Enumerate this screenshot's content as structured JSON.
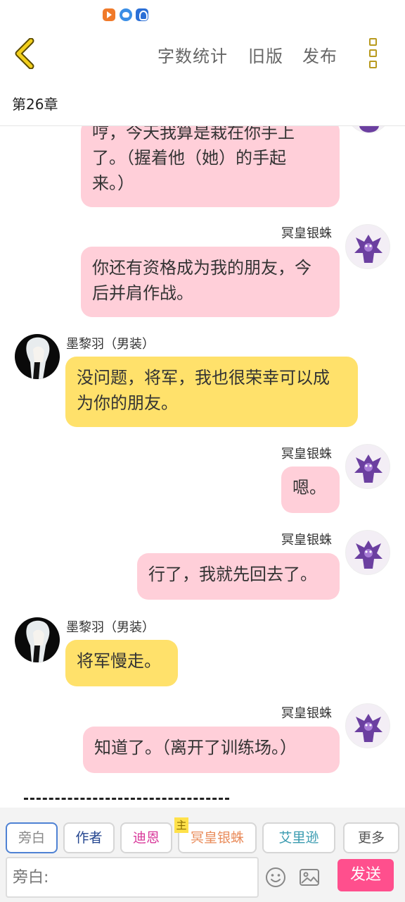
{
  "status_bar": {
    "icons": [
      "play-app-icon",
      "bird-app-icon",
      "bulb-app-icon"
    ]
  },
  "toolbar": {
    "back_icon": "chevron-left-icon",
    "word_count_label": "字数统计",
    "old_version_label": "旧版",
    "publish_label": "发布",
    "menu_icon": "vertical-menu-icon"
  },
  "chapter": {
    "title": "第26章"
  },
  "messages": [
    {
      "side": "right",
      "speaker": "",
      "text": "哼，今天我算是栽在你手上了。（握着他（她）的手起来。）",
      "line1": "哼，今天我算是栽在你手上",
      "line2": "了。（握着他（她）的手起",
      "line3": "来。）"
    },
    {
      "side": "right",
      "speaker": "冥皇银蛛",
      "line1": "你还有资格成为我的朋友，今",
      "line2": "后并肩作战。"
    },
    {
      "side": "left",
      "speaker": "墨黎羽（男装）",
      "line1": "没问题，将军，我也很荣幸可以成",
      "line2": "为你的朋友。"
    },
    {
      "side": "right",
      "speaker": "冥皇银蛛",
      "line1": "嗯。"
    },
    {
      "side": "right",
      "speaker": "冥皇银蛛",
      "line1": "行了，我就先回去了。"
    },
    {
      "side": "left",
      "speaker": "墨黎羽（男装）",
      "line1": "将军慢走。"
    },
    {
      "side": "right",
      "speaker": "冥皇银蛛",
      "line1": "知道了。（离开了训练场。）"
    }
  ],
  "roles": {
    "narrator": "旁白",
    "author": "作者",
    "dien": "迪恩",
    "ming": "冥皇银蛛",
    "ming_badge": "主",
    "ailixun": "艾里逊",
    "more": "更多"
  },
  "input": {
    "placeholder": "旁白:"
  },
  "actions": {
    "emoji_icon": "smiley-icon",
    "image_icon": "image-icon",
    "send_label": "发送"
  },
  "colors": {
    "pink_bubble": "#ffcfd9",
    "yellow_bubble": "#ffe16b",
    "send_button": "#ff4f8d",
    "menu_accent": "#b89a1e"
  }
}
